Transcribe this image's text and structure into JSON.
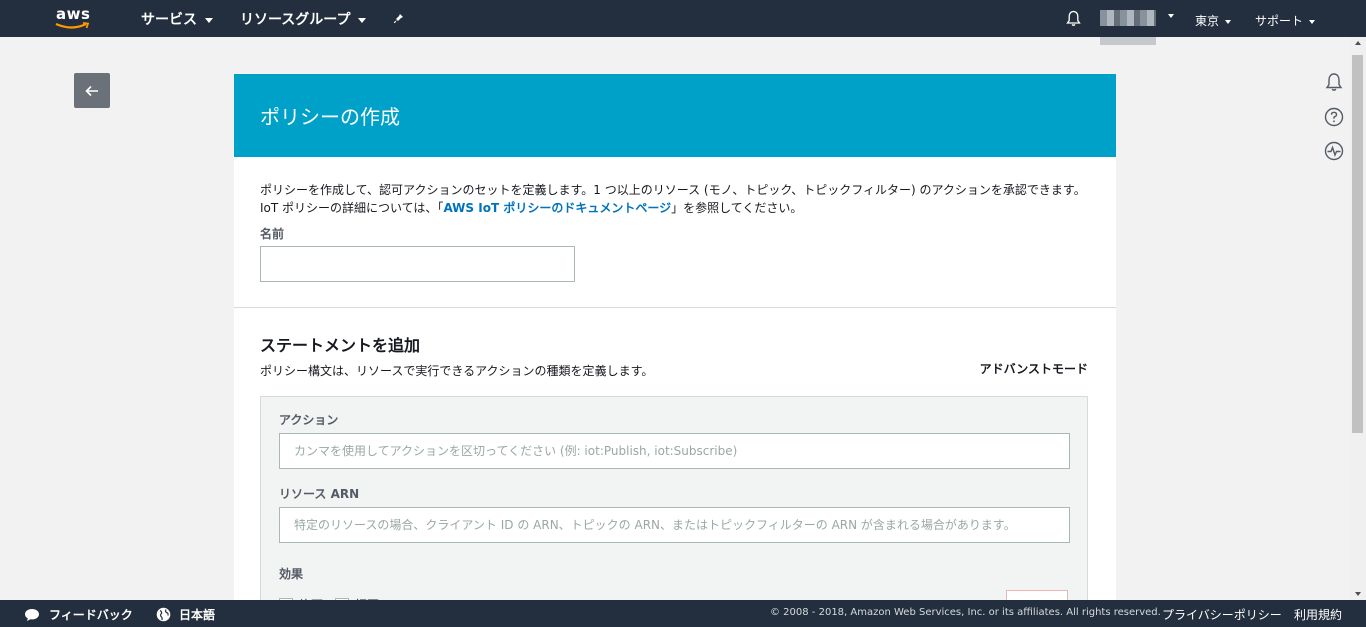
{
  "topnav": {
    "logo_text": "aws",
    "services_label": "サービス",
    "resource_groups_label": "リソースグループ",
    "region_label": "東京",
    "support_label": "サポート"
  },
  "page": {
    "title": "ポリシーの作成",
    "description_part1": "ポリシーを作成して、認可アクションのセットを定義します。1 つ以上のリソース (モノ、トピック、トピックフィルター) のアクションを承認できます。IoT ポリシーの詳細については、「",
    "description_link": "AWS IoT ポリシーのドキュメントページ",
    "description_part2": "」を参照してください。",
    "name_label": "名前",
    "name_value": ""
  },
  "statement": {
    "title": "ステートメントを追加",
    "description": "ポリシー構文は、リソースで実行できるアクションの種類を定義します。",
    "advanced_mode_label": "アドバンストモード",
    "action_label": "アクション",
    "action_placeholder": "カンマを使用してアクションを区切ってください (例: iot:Publish, iot:Subscribe)",
    "resource_label": "リソース ARN",
    "resource_placeholder": "特定のリソースの場合、クライアント ID の ARN、トピックの ARN、またはトピックフィルターの ARN が含まれる場合があります。",
    "effect_label": "効果",
    "allow_label": "許可",
    "deny_label": "拒否"
  },
  "footer": {
    "feedback_label": "フィードバック",
    "language_label": "日本語",
    "copyright": "© 2008 - 2018, Amazon Web Services, Inc. or its affiliates. All rights reserved.",
    "privacy_label": "プライバシーポリシー",
    "terms_label": "利用規約"
  }
}
